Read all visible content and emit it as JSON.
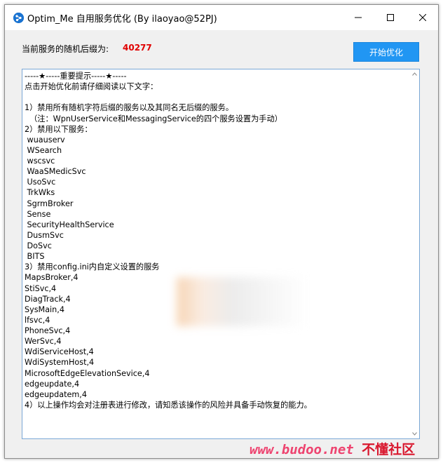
{
  "window": {
    "title": "Optim_Me 自用服务优化 (By ilaoyao@52PJ)"
  },
  "suffix": {
    "label": "当前服务的随机后缀为:",
    "value": "40277",
    "value_color": "#e00000"
  },
  "start_button": {
    "label": "开始优化",
    "color": "#2196f3"
  },
  "textbox": {
    "lines": [
      "-----★-----重要提示-----★-----",
      "点击开始优化前请仔细阅读以下文字：",
      "",
      "1）禁用所有随机字符后缀的服务以及其同名无后缀的服务。",
      "  （注：WpnUserService和MessagingService的四个服务设置为手动）",
      "2）禁用以下服务：",
      " wuauserv",
      " WSearch",
      " wscsvc",
      " WaaSMedicSvc",
      " UsoSvc",
      " TrkWks",
      " SgrmBroker",
      " Sense",
      " SecurityHealthService",
      " DusmSvc",
      " DoSvc",
      " BITS",
      "3）禁用config.ini内自定义设置的服务",
      "MapsBroker,4",
      "StiSvc,4",
      "DiagTrack,4",
      "SysMain,4",
      "lfsvc,4",
      "PhoneSvc,4",
      "WerSvc,4",
      "WdiServiceHost,4",
      "WdiSystemHost,4",
      "MicrosoftEdgeElevationSevice,4",
      "edgeupdate,4",
      "edgeupdatem,4",
      "4）以上操作均会对注册表进行修改，请知悉该操作的风险并具备手动恢复的能力。"
    ]
  },
  "watermark": {
    "url": "www.budoo.net",
    "cn": "不懂社区"
  },
  "icons": {
    "app": "app-icon",
    "minimize": "minimize-icon",
    "maximize": "maximize-icon",
    "close": "close-icon"
  }
}
